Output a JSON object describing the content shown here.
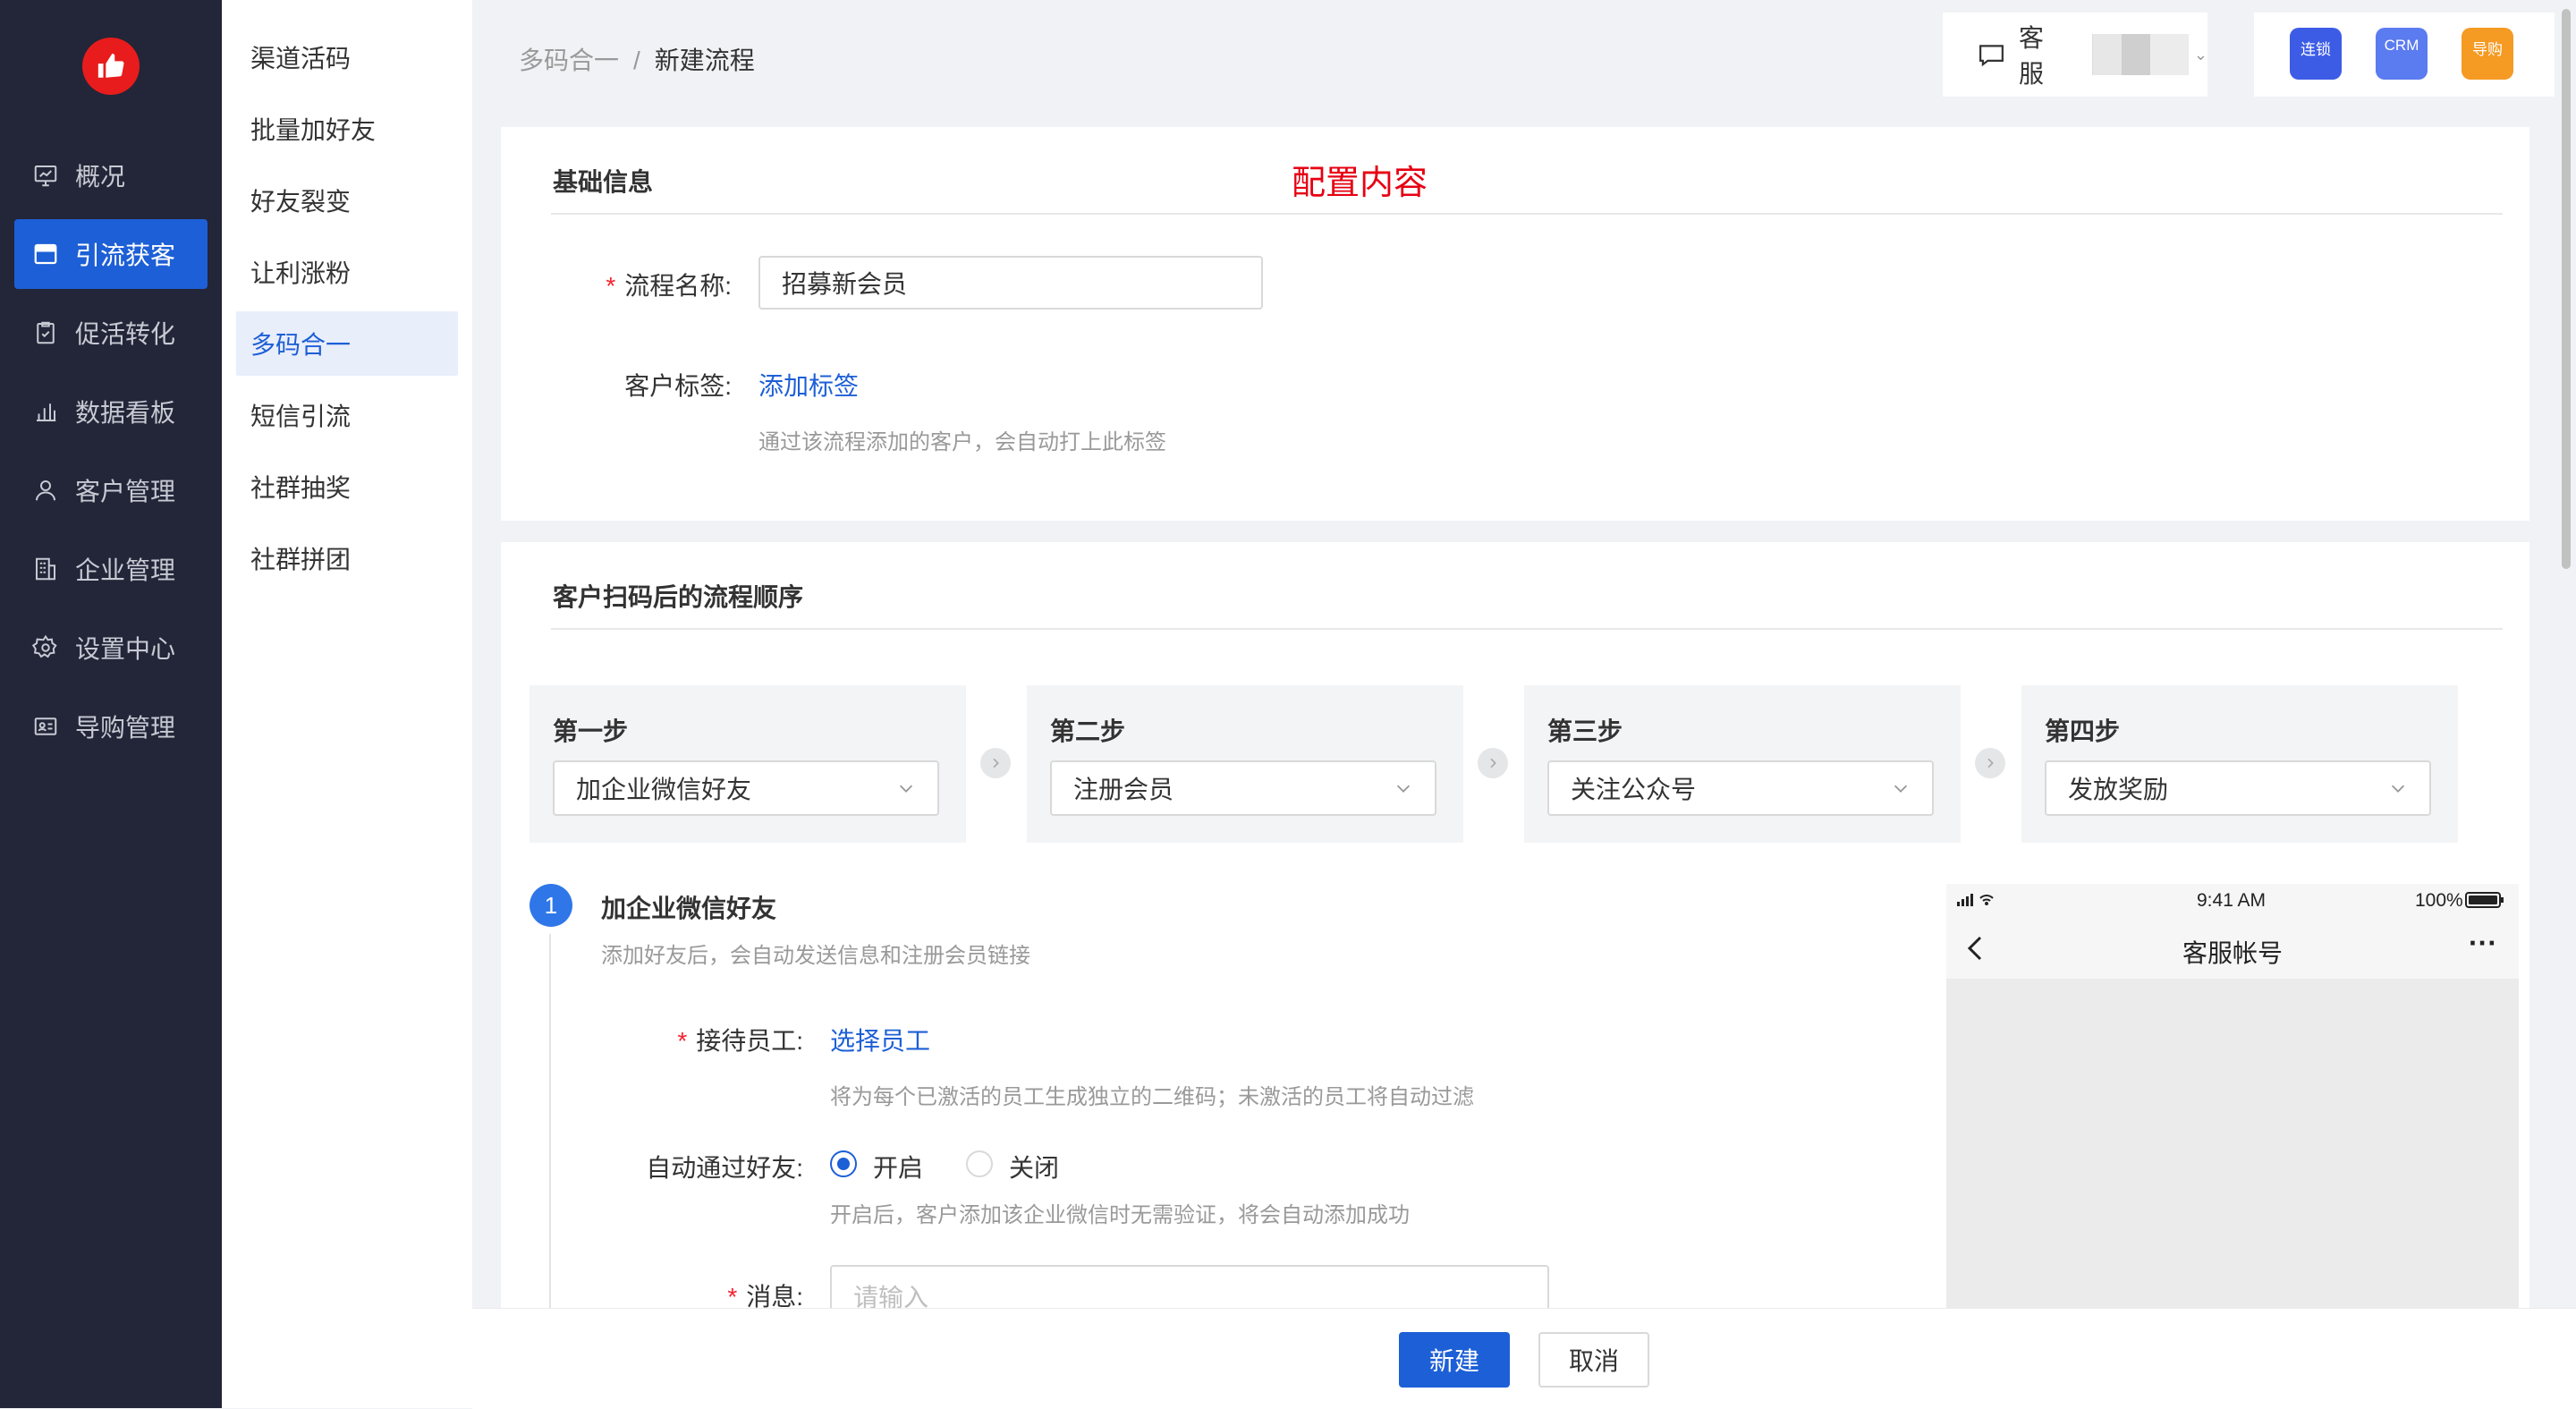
{
  "nav": {
    "items": [
      {
        "label": "概况",
        "icon": "overview-icon"
      },
      {
        "label": "引流获客",
        "icon": "store-icon"
      },
      {
        "label": "促活转化",
        "icon": "clipboard-icon"
      },
      {
        "label": "数据看板",
        "icon": "bar-chart-icon"
      },
      {
        "label": "客户管理",
        "icon": "user-icon"
      },
      {
        "label": "企业管理",
        "icon": "building-icon"
      },
      {
        "label": "设置中心",
        "icon": "gear-icon"
      },
      {
        "label": "导购管理",
        "icon": "id-card-icon"
      }
    ],
    "active_index": 1
  },
  "submenu": {
    "items": [
      "渠道活码",
      "批量加好友",
      "好友裂变",
      "让利涨粉",
      "多码合一",
      "短信引流",
      "社群抽奖",
      "社群拼团"
    ],
    "active_index": 4
  },
  "breadcrumb": {
    "parent": "多码合一",
    "separator": "/",
    "current": "新建流程"
  },
  "header": {
    "service_label": "客服",
    "apps": [
      {
        "label": "连锁",
        "color": "#3d5ce6"
      },
      {
        "label": "CRM",
        "color": "#5b7bf0"
      },
      {
        "label": "导购",
        "color": "#f59a23"
      }
    ]
  },
  "basic": {
    "title": "基础信息",
    "annotation": "配置内容",
    "name_label": "流程名称:",
    "name_value": "招募新会员",
    "tag_label": "客户标签:",
    "tag_link": "添加标签",
    "tag_hint": "通过该流程添加的客户，会自动打上此标签"
  },
  "flow": {
    "title": "客户扫码后的流程顺序",
    "steps": [
      {
        "title": "第一步",
        "value": "加企业微信好友"
      },
      {
        "title": "第二步",
        "value": "注册会员"
      },
      {
        "title": "第三步",
        "value": "关注公众号"
      },
      {
        "title": "第四步",
        "value": "发放奖励"
      }
    ]
  },
  "detail": {
    "number": "1",
    "title": "加企业微信好友",
    "desc": "添加好友后，会自动发送信息和注册会员链接",
    "staff_label": "接待员工:",
    "staff_link": "选择员工",
    "staff_hint": "将为每个已激活的员工生成独立的二维码；未激活的员工将自动过滤",
    "auto_label": "自动通过好友:",
    "auto_on": "开启",
    "auto_off": "关闭",
    "auto_selected": "开启",
    "auto_hint": "开启后，客户添加该企业微信时无需验证，将会自动添加成功",
    "msg_label": "消息:",
    "msg_placeholder": "请输入"
  },
  "phone": {
    "time": "9:41 AM",
    "battery": "100%",
    "title": "客服帐号",
    "more": "···"
  },
  "footer": {
    "create": "新建",
    "cancel": "取消"
  }
}
